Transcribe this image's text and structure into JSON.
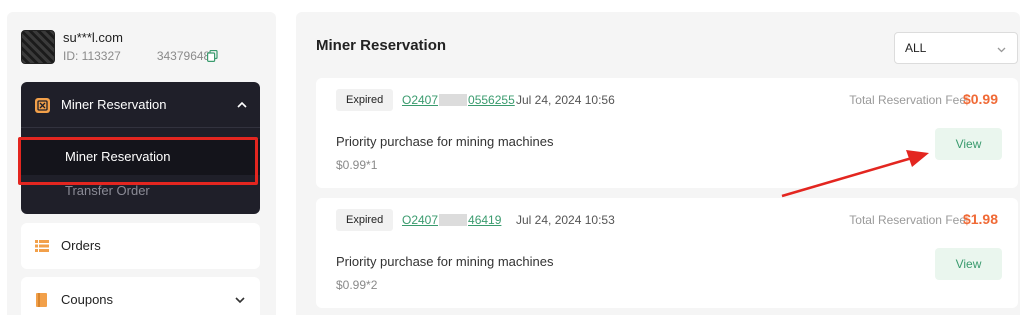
{
  "user": {
    "email": "su***l.com",
    "id": "ID: 113327   34379648"
  },
  "sidebar": {
    "section_title": "Miner Reservation",
    "sub_items": [
      "Miner Reservation",
      "Transfer Order"
    ],
    "orders_label": "Orders",
    "coupons_label": "Coupons"
  },
  "main": {
    "title": "Miner Reservation",
    "filter_value": "ALL",
    "fee_label": "Total Reservation Fee",
    "view_label": "View",
    "orders": [
      {
        "status": "Expired",
        "id_prefix": "O2407",
        "id_suffix": "0556255",
        "time": "Jul 24, 2024 10:56",
        "fee": "$0.99",
        "product": "Priority purchase for mining machines",
        "qty": "$0.99*1"
      },
      {
        "status": "Expired",
        "id_prefix": "O2407",
        "id_suffix": "46419",
        "time": "Jul 24, 2024 10:53",
        "fee": "$1.98",
        "product": "Priority purchase for mining machines",
        "qty": "$0.99*2"
      }
    ]
  },
  "colors": {
    "accent_orange": "#f06a36",
    "accent_green": "#3a9b6e",
    "highlight_red": "#e32620",
    "menu_dark": "#1f1f29"
  }
}
